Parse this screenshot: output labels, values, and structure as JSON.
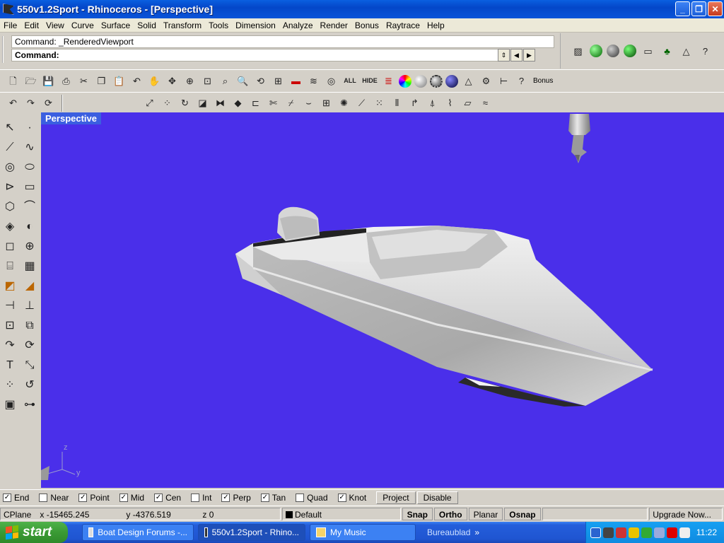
{
  "window": {
    "title": "550v1.2Sport - Rhinoceros - [Perspective]",
    "minimize": "_",
    "maximize": "❐",
    "close": "✕"
  },
  "menu": [
    "File",
    "Edit",
    "View",
    "Curve",
    "Surface",
    "Solid",
    "Transform",
    "Tools",
    "Dimension",
    "Analyze",
    "Render",
    "Bonus",
    "Raytrace",
    "Help"
  ],
  "command": {
    "history": "Command: _RenderedViewport",
    "prompt": "Command:"
  },
  "toolbar": {
    "all_label": "ALL",
    "hide_label": "HIDE",
    "bonus_label": "Bonus"
  },
  "viewport": {
    "name": "Perspective",
    "background": "#4a2fea",
    "axis_z": "z",
    "axis_y": "y"
  },
  "osnap": {
    "items": [
      {
        "label": "End",
        "checked": true
      },
      {
        "label": "Near",
        "checked": false
      },
      {
        "label": "Point",
        "checked": true
      },
      {
        "label": "Mid",
        "checked": true
      },
      {
        "label": "Cen",
        "checked": true
      },
      {
        "label": "Int",
        "checked": false
      },
      {
        "label": "Perp",
        "checked": true
      },
      {
        "label": "Tan",
        "checked": true
      },
      {
        "label": "Quad",
        "checked": false
      },
      {
        "label": "Knot",
        "checked": true
      }
    ],
    "project": "Project",
    "disable": "Disable"
  },
  "status": {
    "cplane": "CPlane",
    "x": "x -15465.245",
    "y": "y -4376.519",
    "z": "z 0",
    "layer": "Default",
    "snap": "Snap",
    "ortho": "Ortho",
    "planar": "Planar",
    "osnap": "Osnap",
    "upgrade": "Upgrade Now..."
  },
  "taskbar": {
    "start": "start",
    "tasks": [
      {
        "label": "Boat Design Forums -...",
        "active": false
      },
      {
        "label": "550v1.2Sport - Rhino...",
        "active": true
      },
      {
        "label": "My Music",
        "active": false
      }
    ],
    "tray_label": "Bureaublad",
    "clock": "11:22"
  }
}
